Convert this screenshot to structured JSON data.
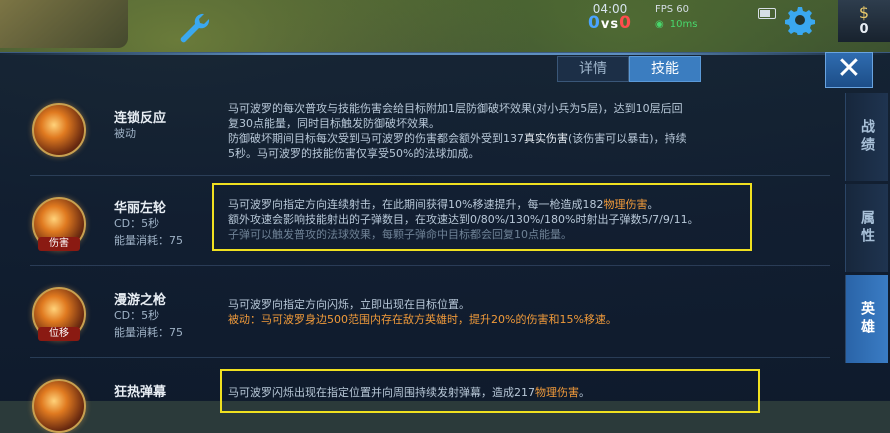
{
  "hud": {
    "time": "04:00",
    "score_blue": "0",
    "score_vs": "vs",
    "score_red": "0",
    "fps": "FPS 60",
    "ping": "10ms",
    "money": "0"
  },
  "tabs": [
    {
      "label": "详情"
    },
    {
      "label": "技能"
    }
  ],
  "close_label": "✕",
  "side_tabs": [
    {
      "label": "战绩"
    },
    {
      "label": "属性"
    },
    {
      "label": "英雄"
    }
  ],
  "skills": [
    {
      "name": "连锁反应",
      "type": "被动",
      "line1": "马可波罗的每次普攻与技能伤害会给目标附加1层防御破坏效果(对小兵为5层)，达到10层后回",
      "line2": "复30点能量，同时目标触发防御破坏效果。",
      "line3a": "防御破坏期间目标每次受到马可波罗的伤害都会额外受到137",
      "line3b": "真实伤害",
      "line3c": "(该伤害可以暴击)，持续",
      "line4": "5秒。马可波罗的技能伤害仅享受50%的法球加成。"
    },
    {
      "name": "华丽左轮",
      "cd": "CD：5秒",
      "cost": "能量消耗：75",
      "badge": "伤害",
      "line1a": "马可波罗向指定方向连续射击，在此期间获得10%移速提升，每一枪造成182",
      "line1b": "物理伤害",
      "line1c": "。",
      "line2": "额外攻速会影响技能射出的子弹数目，在攻速达到0/80%/130%/180%时射出子弹数5/7/9/11。",
      "line3": "子弹可以触发普攻的法球效果，每颗子弹命中目标都会回复10点能量。"
    },
    {
      "name": "漫游之枪",
      "cd": "CD：5秒",
      "cost": "能量消耗：75",
      "badge": "位移",
      "line1": "马可波罗向指定方向闪烁，立即出现在目标位置。",
      "line2": "被动：马可波罗身边500范围内存在敌方英雄时，提升20%的伤害和15%移速。"
    },
    {
      "name": "狂热弹幕",
      "line1a": "马可波罗闪烁出现在指定位置并向周围持续发射弹幕，造成217",
      "line1b": "物理伤害",
      "line1c": "。"
    }
  ],
  "icons": [
    "wrench-icon",
    "gear-icon",
    "money-bag-icon",
    "close-icon",
    "battery-icon",
    "wifi-icon"
  ],
  "colors": {
    "accent": "#3b7dc0",
    "highlight": "#f0e020",
    "damage": "#f09a3a"
  }
}
